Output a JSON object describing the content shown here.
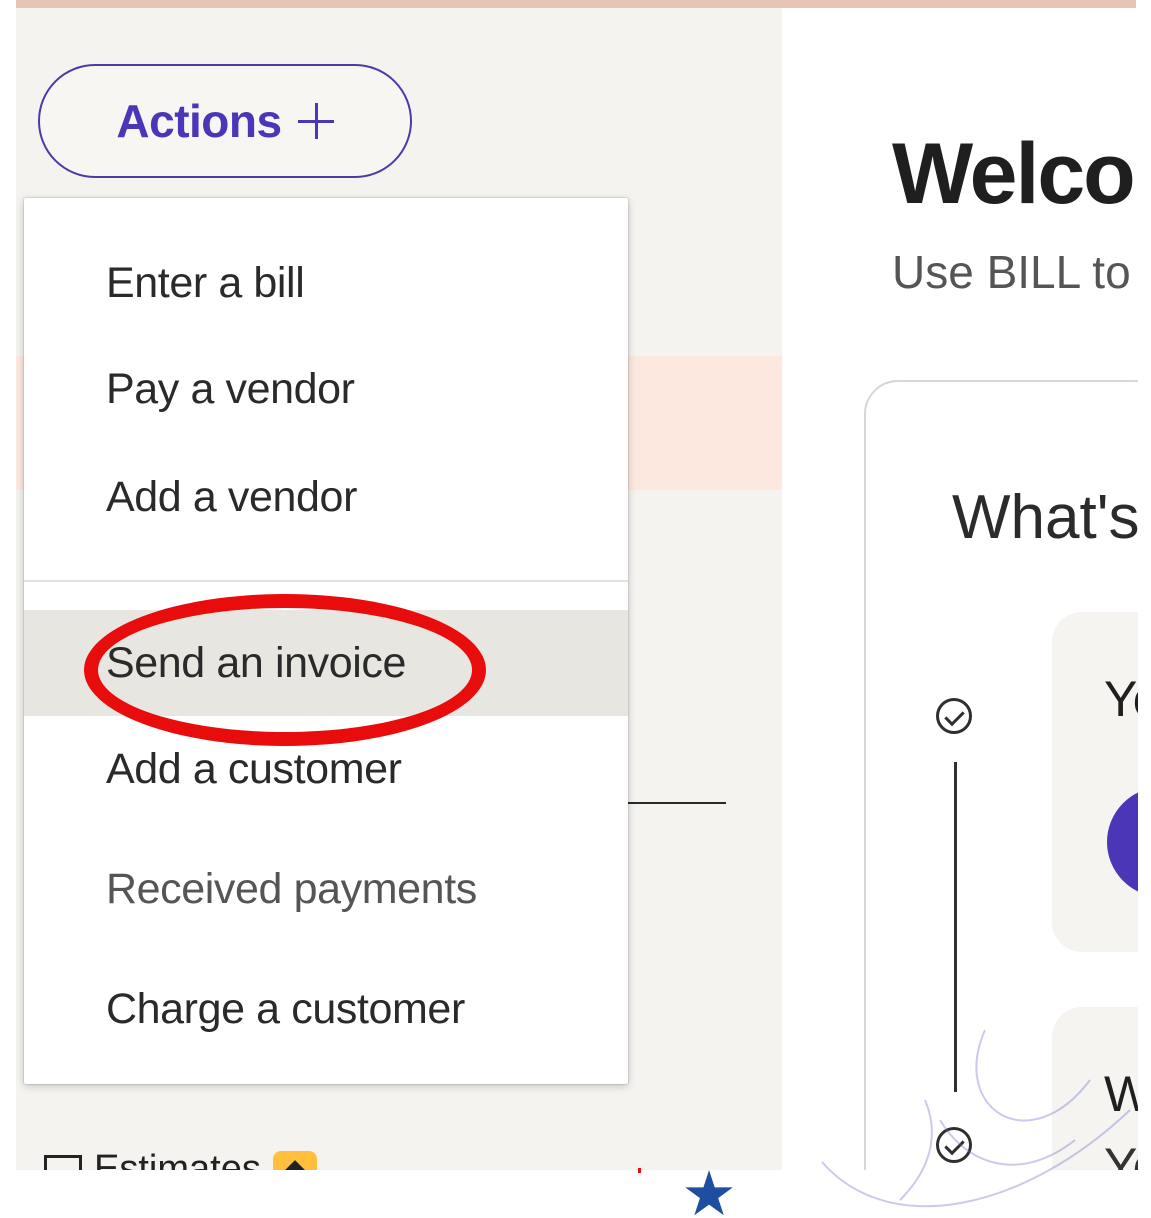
{
  "actions_button": {
    "label": "Actions",
    "icon": "plus-icon"
  },
  "actions_menu": {
    "items": [
      {
        "label": "Enter a bill"
      },
      {
        "label": "Pay a vendor"
      },
      {
        "label": "Add a vendor"
      },
      {
        "label": "Send an invoice"
      },
      {
        "label": "Add a customer"
      },
      {
        "label": "Received payments"
      },
      {
        "label": "Charge a customer"
      }
    ],
    "selected_item": "Send an invoice"
  },
  "sidebar": {
    "next_item_label": "Estimates",
    "next_item_icon": "estimates-icon",
    "badge_icon": "diamond-icon"
  },
  "main": {
    "title": "Welco",
    "subtitle": "Use BILL to",
    "checklist_title": "What's",
    "step_1_partial": "Yo",
    "step_2_partial": "W",
    "step_2_subtext_partial": "Yo"
  },
  "colors": {
    "brand_purple": "#4c36b8",
    "annotation_red": "#e90c0c",
    "sidebar_background": "#f4f3ef",
    "selected_item_background": "#e8e6e1"
  }
}
